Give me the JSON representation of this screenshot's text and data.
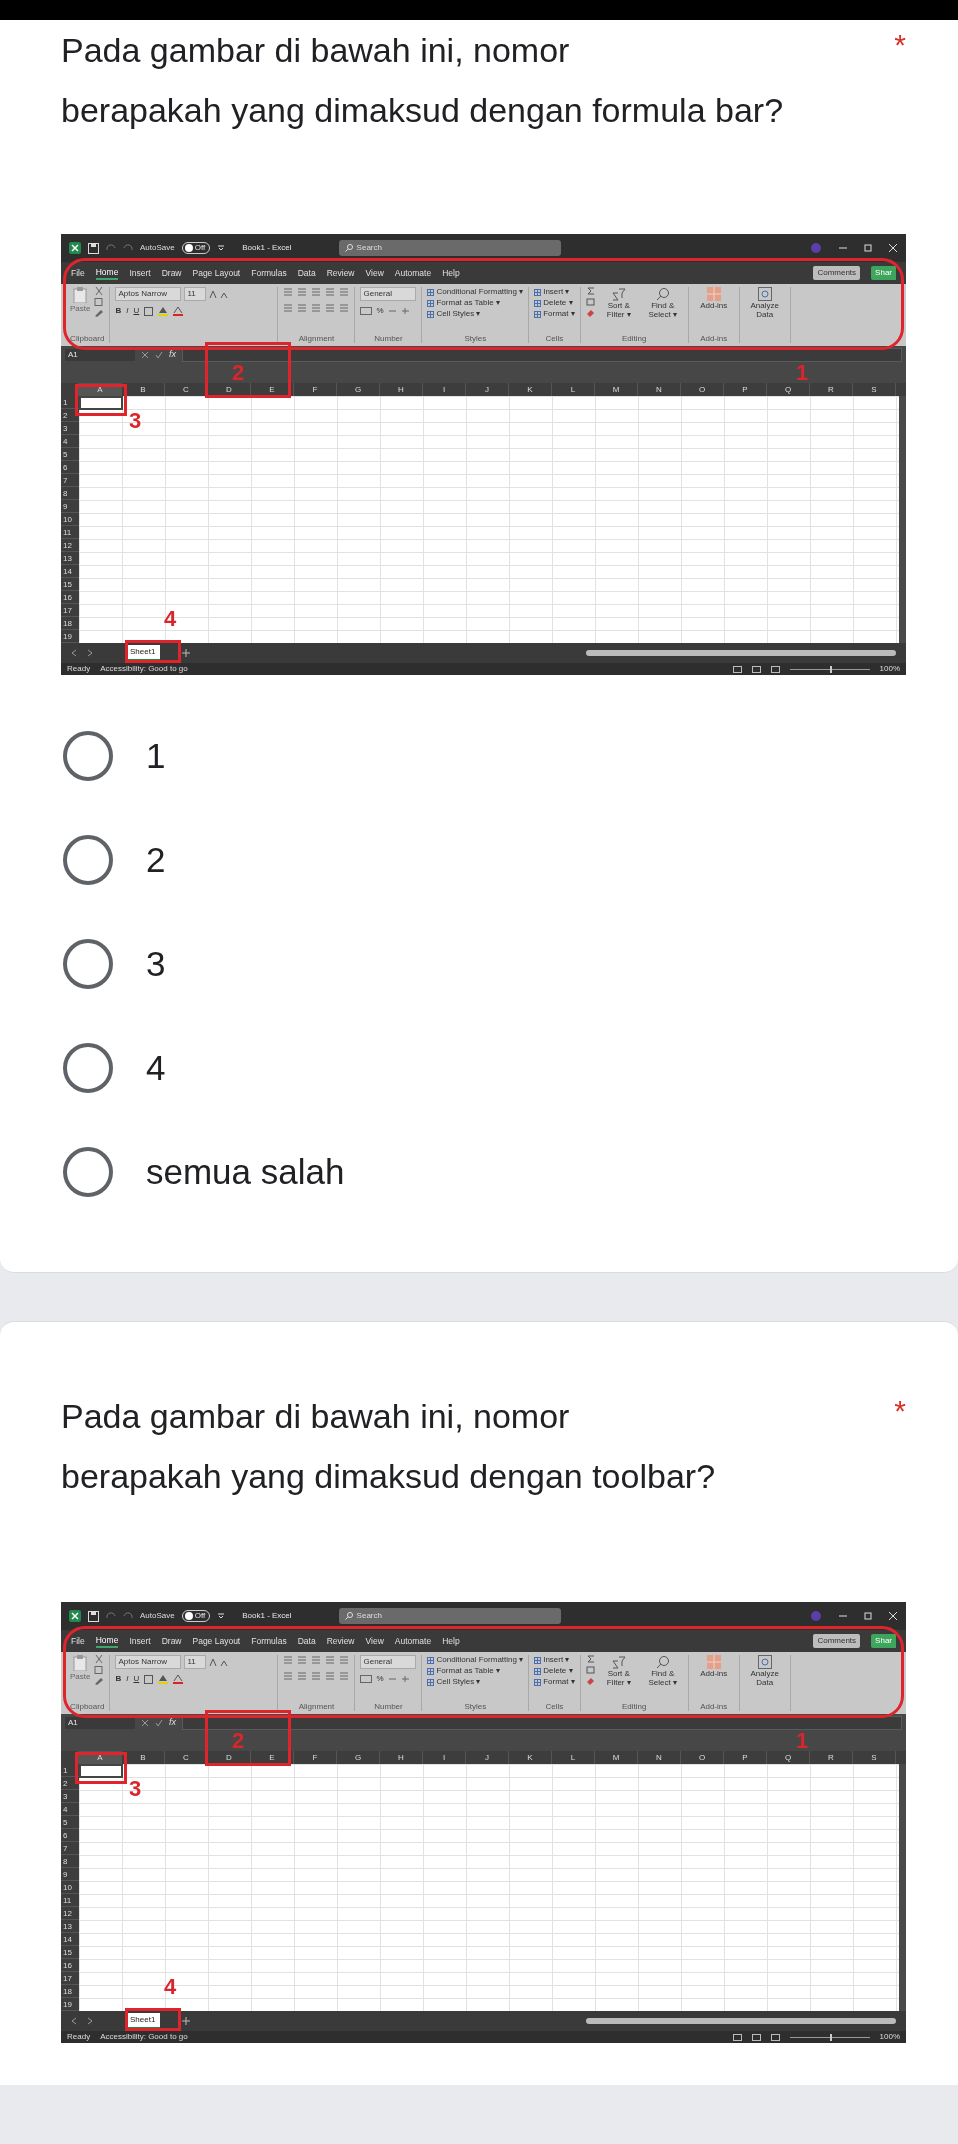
{
  "questions": [
    {
      "title": "Pada gambar di bawah ini, nomor\nberapakah yang dimaksud dengan formula bar?",
      "required_mark": "*",
      "image": {
        "autosave": "AutoSave",
        "autosave_state": "Off",
        "doc_title": "Book1 - Excel",
        "search_placeholder": "Search",
        "menu": [
          {
            "label": "File",
            "selected": false
          },
          {
            "label": "Home",
            "selected": true
          },
          {
            "label": "Insert",
            "selected": false
          },
          {
            "label": "Draw",
            "selected": false
          },
          {
            "label": "Page Layout",
            "selected": false
          },
          {
            "label": "Formulas",
            "selected": false
          },
          {
            "label": "Data",
            "selected": false
          },
          {
            "label": "Review",
            "selected": false
          },
          {
            "label": "View",
            "selected": false
          },
          {
            "label": "Automate",
            "selected": false
          },
          {
            "label": "Help",
            "selected": false
          }
        ],
        "comments": "Comments",
        "share": "Shar",
        "ribbon": [
          {
            "kind": "clipboard",
            "label": "Clipboard",
            "items": [
              "Paste"
            ]
          },
          {
            "kind": "font",
            "items": [
              "Aptos Narrow",
              "11",
              "B",
              "I",
              "U"
            ]
          },
          {
            "kind": "alignment",
            "label": "Alignment"
          },
          {
            "kind": "number",
            "label": "Number",
            "items": [
              "General",
              "%"
            ]
          },
          {
            "kind": "list",
            "label": "Styles",
            "items": [
              "Conditional Formatting ▾",
              "Format as Table ▾",
              "Cell Styles ▾"
            ]
          },
          {
            "kind": "list",
            "label": "Cells",
            "items": [
              "Insert ▾",
              "Delete ▾",
              "Format ▾"
            ]
          },
          {
            "kind": "editing",
            "label": "Editing",
            "items": [
              "Sort & Filter ▾",
              "Find & Select ▾"
            ]
          },
          {
            "kind": "big",
            "label": "Add-ins",
            "items": [
              "Add-ins"
            ]
          },
          {
            "kind": "big",
            "items": [
              "Analyze Data"
            ]
          }
        ],
        "name_box": "A1",
        "fx": "fx",
        "columns": [
          "A",
          "B",
          "C",
          "D",
          "E",
          "F",
          "G",
          "H",
          "I",
          "J",
          "K",
          "L",
          "M",
          "N",
          "O",
          "P",
          "Q",
          "R",
          "S"
        ],
        "rows": [
          "1",
          "2",
          "3",
          "4",
          "5",
          "6",
          "7",
          "8",
          "9",
          "10",
          "11",
          "12",
          "13",
          "14",
          "15",
          "16",
          "17",
          "18",
          "19"
        ],
        "sheet_tabs": [
          {
            "label": "Sheet1",
            "selected": true
          }
        ],
        "status": "Ready",
        "accessibility": "Accessibility: Good to go",
        "zoom_slider": {
          "level": 0.5
        },
        "zoom": "100%",
        "annotations": [
          {
            "label": "1"
          },
          {
            "label": "2"
          },
          {
            "label": "3"
          },
          {
            "label": "4"
          }
        ]
      },
      "options": [
        {
          "label": "1",
          "selected": false
        },
        {
          "label": "2",
          "selected": false
        },
        {
          "label": "3",
          "selected": false
        },
        {
          "label": "4",
          "selected": false
        },
        {
          "label": "semua salah",
          "selected": false
        }
      ]
    },
    {
      "title": "Pada gambar di bawah ini, nomor\nberapakah yang dimaksud dengan toolbar?",
      "required_mark": "*",
      "image": {
        "autosave": "AutoSave",
        "autosave_state": "Off",
        "doc_title": "Book1 - Excel",
        "search_placeholder": "Search",
        "menu": [
          {
            "label": "File",
            "selected": false
          },
          {
            "label": "Home",
            "selected": true
          },
          {
            "label": "Insert",
            "selected": false
          },
          {
            "label": "Draw",
            "selected": false
          },
          {
            "label": "Page Layout",
            "selected": false
          },
          {
            "label": "Formulas",
            "selected": false
          },
          {
            "label": "Data",
            "selected": false
          },
          {
            "label": "Review",
            "selected": false
          },
          {
            "label": "View",
            "selected": false
          },
          {
            "label": "Automate",
            "selected": false
          },
          {
            "label": "Help",
            "selected": false
          }
        ],
        "comments": "Comments",
        "share": "Shar",
        "ribbon": [
          {
            "kind": "clipboard",
            "label": "Clipboard",
            "items": [
              "Paste"
            ]
          },
          {
            "kind": "font",
            "items": [
              "Aptos Narrow",
              "11",
              "B",
              "I",
              "U"
            ]
          },
          {
            "kind": "alignment",
            "label": "Alignment"
          },
          {
            "kind": "number",
            "label": "Number",
            "items": [
              "General",
              "%"
            ]
          },
          {
            "kind": "list",
            "label": "Styles",
            "items": [
              "Conditional Formatting ▾",
              "Format as Table ▾",
              "Cell Styles ▾"
            ]
          },
          {
            "kind": "list",
            "label": "Cells",
            "items": [
              "Insert ▾",
              "Delete ▾",
              "Format ▾"
            ]
          },
          {
            "kind": "editing",
            "label": "Editing",
            "items": [
              "Sort & Filter ▾",
              "Find & Select ▾"
            ]
          },
          {
            "kind": "big",
            "label": "Add-ins",
            "items": [
              "Add-ins"
            ]
          },
          {
            "kind": "big",
            "items": [
              "Analyze Data"
            ]
          }
        ],
        "name_box": "A1",
        "fx": "fx",
        "columns": [
          "A",
          "B",
          "C",
          "D",
          "E",
          "F",
          "G",
          "H",
          "I",
          "J",
          "K",
          "L",
          "M",
          "N",
          "O",
          "P",
          "Q",
          "R",
          "S"
        ],
        "rows": [
          "1",
          "2",
          "3",
          "4",
          "5",
          "6",
          "7",
          "8",
          "9",
          "10",
          "11",
          "12",
          "13",
          "14",
          "15",
          "16",
          "17",
          "18",
          "19"
        ],
        "sheet_tabs": [
          {
            "label": "Sheet1",
            "selected": true
          }
        ],
        "status": "Ready",
        "accessibility": "Accessibility: Good to go",
        "zoom_slider": {
          "level": 0.5
        },
        "zoom": "100%",
        "annotations": [
          {
            "label": "1"
          },
          {
            "label": "2"
          },
          {
            "label": "3"
          },
          {
            "label": "4"
          }
        ]
      }
    }
  ]
}
